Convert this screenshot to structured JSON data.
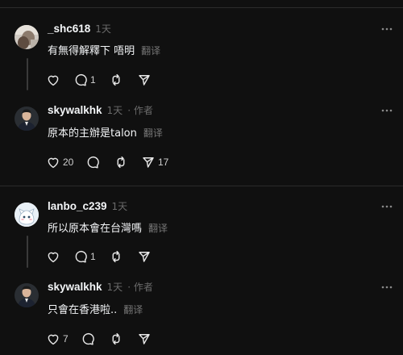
{
  "posts": [
    {
      "username": "_shc618",
      "time": "1天",
      "author_tag": "",
      "text": "有無得解釋下 唔明",
      "translate": "翻译",
      "counts": {
        "like": "",
        "reply": "1",
        "repost": "",
        "share": ""
      }
    },
    {
      "username": "skywalkhk",
      "time": "1天",
      "author_tag": "· 作者",
      "text": "原本的主辦是talon",
      "translate": "翻译",
      "counts": {
        "like": "20",
        "reply": "",
        "repost": "",
        "share": "17"
      }
    },
    {
      "username": "lanbo_c239",
      "time": "1天",
      "author_tag": "",
      "text": "所以原本會在台灣嗎",
      "translate": "翻译",
      "counts": {
        "like": "",
        "reply": "1",
        "repost": "",
        "share": ""
      }
    },
    {
      "username": "skywalkhk",
      "time": "1天",
      "author_tag": "· 作者",
      "text": "只會在香港啦..",
      "translate": "翻译",
      "counts": {
        "like": "7",
        "reply": "",
        "repost": "",
        "share": ""
      }
    }
  ],
  "icons": {
    "more": "more-horizontal-icon",
    "like": "heart-icon",
    "reply": "comment-icon",
    "repost": "repost-icon",
    "share": "send-icon"
  },
  "colors": {
    "background": "#101010",
    "text": "#f3f5f7",
    "muted": "#6b6b6b",
    "divider": "#2b2b2b"
  }
}
